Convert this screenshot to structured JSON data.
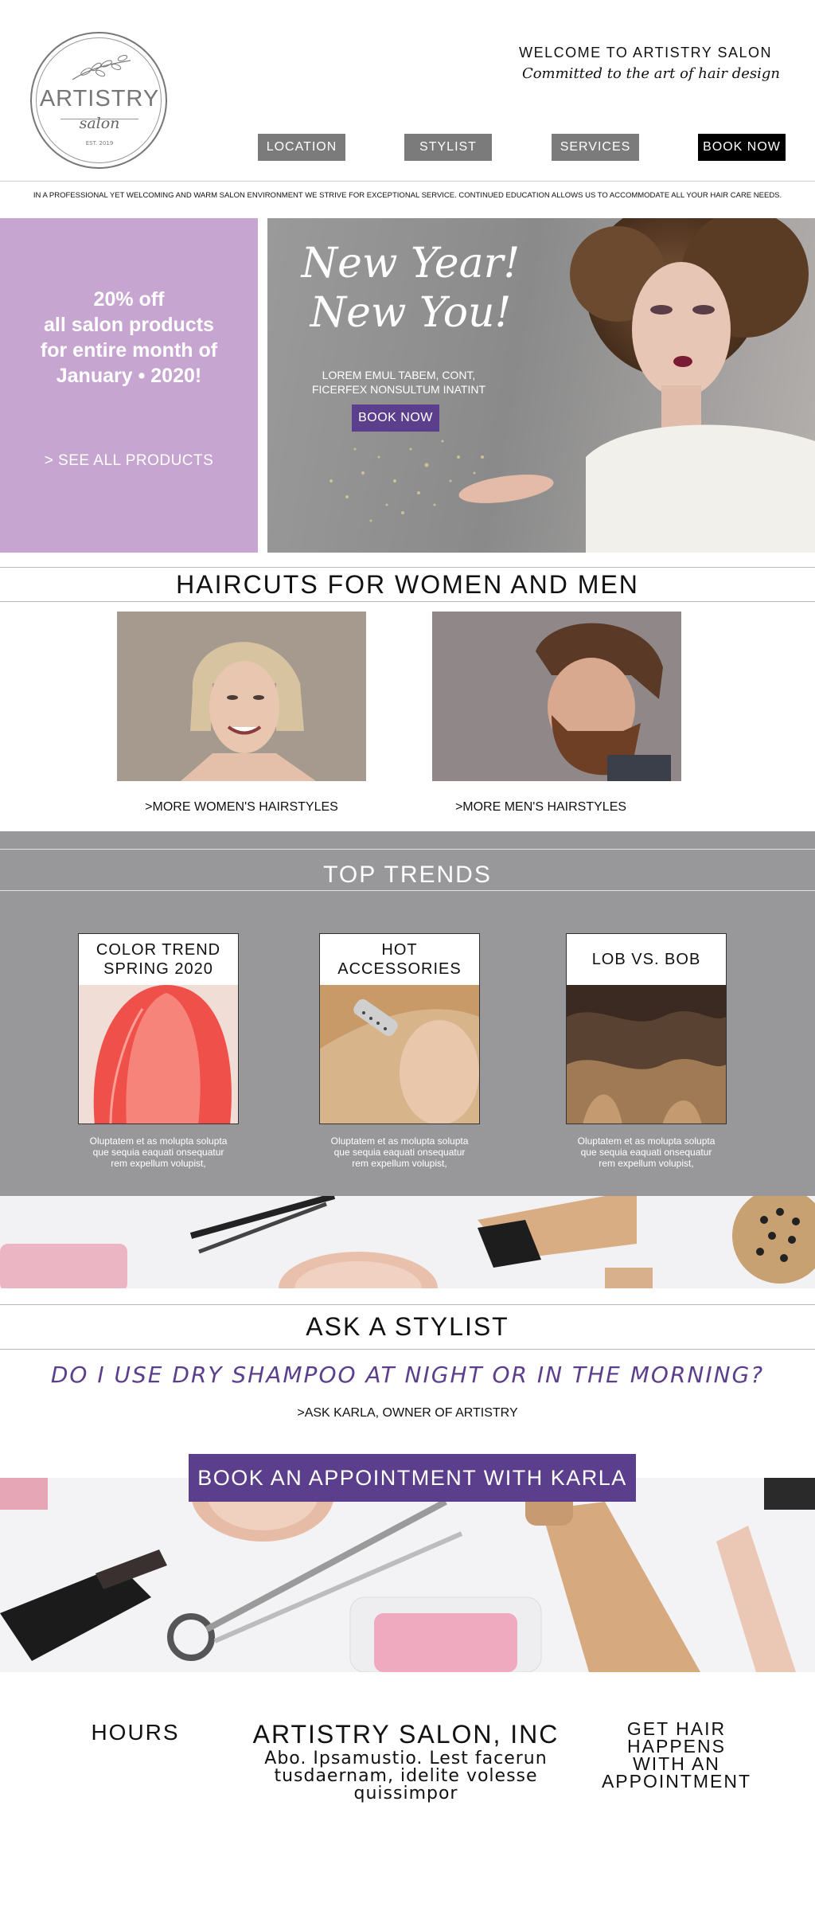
{
  "header": {
    "logo": {
      "name": "ARTISTRY",
      "sub": "salon",
      "est": "EST. 2019"
    },
    "welcome": "WELCOME TO ARTISTRY SALON",
    "tagline": "Committed to the art of hair design",
    "nav": [
      {
        "label": "LOCATION"
      },
      {
        "label": "STYLIST"
      },
      {
        "label": "SERVICES"
      },
      {
        "label": "BOOK NOW"
      }
    ],
    "intro": "IN A PROFESSIONAL YET WELCOMING AND WARM SALON ENVIRONMENT WE STRIVE FOR EXCEPTIONAL SERVICE. CONTINUED EDUCATION ALLOWS US TO ACCOMMODATE ALL YOUR HAIR CARE NEEDS."
  },
  "promo": {
    "line1": "20% off",
    "line2": "all salon products",
    "line3": "for entire month of",
    "line4": "January • 2020!",
    "link": "> SEE ALL PRODUCTS"
  },
  "hero": {
    "title1": "New Year!",
    "title2": "New You!",
    "sub1": "LOREM EMUL TABEM, CONT,",
    "sub2": "FICERFEX NONSULTUM INATINT",
    "button": "BOOK NOW"
  },
  "haircuts": {
    "title": "HAIRCUTS FOR WOMEN AND MEN",
    "women_link": ">MORE WOMEN'S HAIRSTYLES",
    "men_link": ">MORE MEN'S HAIRSTYLES"
  },
  "trends": {
    "title": "TOP TRENDS",
    "cards": [
      {
        "line1": "COLOR TREND",
        "line2": "SPRING 2020",
        "desc1": "Oluptatem et as molupta solupta",
        "desc2": "que sequia eaquati onsequatur",
        "desc3": "rem expellum volupist,"
      },
      {
        "line1": "HOT",
        "line2": "ACCESSORIES",
        "desc1": "Oluptatem et as molupta solupta",
        "desc2": "que sequia eaquati onsequatur",
        "desc3": "rem expellum volupist,"
      },
      {
        "line1": "LOB VS. BOB",
        "line2": "",
        "desc1": "Oluptatem et as molupta solupta",
        "desc2": "que sequia eaquati onsequatur",
        "desc3": "rem expellum volupist,"
      }
    ]
  },
  "ask": {
    "title": "ASK A STYLIST",
    "question": "DO I USE DRY SHAMPOO AT NIGHT OR IN THE MORNING?",
    "link": ">ASK KARLA, OWNER OF ARTISTRY",
    "button": "BOOK AN APPOINTMENT WITH KARLA"
  },
  "footer": {
    "hours": "HOURS",
    "company": "ARTISTRY SALON, INC",
    "address1": "Abo. Ipsamustio. Lest facerun",
    "address2": "tusdaernam, idelite volesse",
    "address3": "quissimpor",
    "get1": "GET HAIR",
    "get2": "HAPPENS",
    "get3": "WITH AN",
    "get4": "APPOINTMENT"
  },
  "colors": {
    "accent_purple": "#5c3f8c",
    "promo_lavender": "#c6a5d0",
    "trends_gray": "#98989a",
    "nav_gray": "#7b7b7b"
  }
}
